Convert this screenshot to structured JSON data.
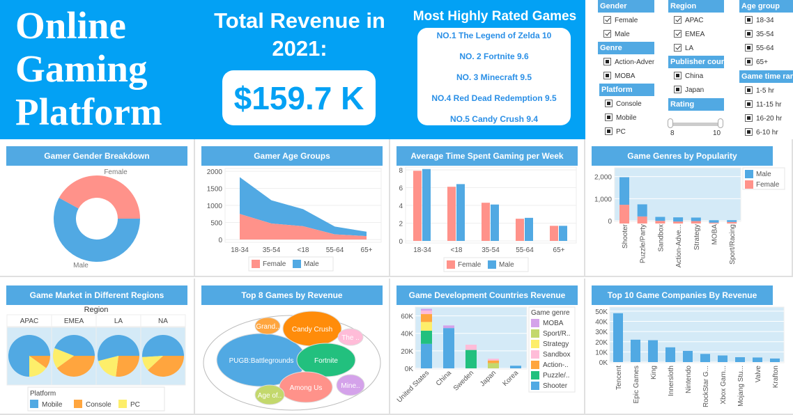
{
  "header": {
    "app_title": "Online Gaming Platform",
    "revenue_title": "Total Revenue in 2021:",
    "revenue_value": "$159.7 K",
    "rated_title": "Most Highly Rated Games",
    "rated_games": [
      "NO.1 The Legend of Zelda 10",
      "NO. 2 Fortnite  9.6",
      "NO. 3 Minecraft 9.5",
      "NO.4 Red Dead Redemption 9.5",
      "NO.5 Candy Crush  9.4"
    ]
  },
  "filters": {
    "gender": {
      "label": "Gender",
      "items": [
        {
          "label": "Female",
          "state": "checked"
        },
        {
          "label": "Male",
          "state": "checked"
        }
      ]
    },
    "genre": {
      "label": "Genre",
      "items": [
        {
          "label": "Action-Adventure",
          "state": "partial"
        },
        {
          "label": "MOBA",
          "state": "partial"
        }
      ]
    },
    "platform": {
      "label": "Platform",
      "items": [
        {
          "label": "Console",
          "state": "partial"
        },
        {
          "label": "Mobile",
          "state": "partial"
        },
        {
          "label": "PC",
          "state": "partial"
        }
      ]
    },
    "region": {
      "label": "Region",
      "items": [
        {
          "label": "APAC",
          "state": "checked"
        },
        {
          "label": "EMEA",
          "state": "checked"
        },
        {
          "label": "LA",
          "state": "checked"
        }
      ]
    },
    "publisher": {
      "label": "Publisher country",
      "items": [
        {
          "label": "China",
          "state": "partial"
        },
        {
          "label": "Japan",
          "state": "partial"
        }
      ]
    },
    "rating": {
      "label": "Rating",
      "min_label": "8",
      "max_label": "10",
      "range": [
        8,
        10
      ]
    },
    "age_group": {
      "label": "Age group",
      "items": [
        {
          "label": "18-34",
          "state": "partial"
        },
        {
          "label": "35-54",
          "state": "partial"
        },
        {
          "label": "55-64",
          "state": "partial"
        },
        {
          "label": "65+",
          "state": "partial"
        }
      ]
    },
    "game_time": {
      "label": "Game time range",
      "items": [
        {
          "label": "1-5 hr",
          "state": "partial"
        },
        {
          "label": "11-15 hr",
          "state": "partial"
        },
        {
          "label": "16-20 hr",
          "state": "partial"
        },
        {
          "label": "6-10 hr",
          "state": "partial"
        }
      ]
    }
  },
  "colors": {
    "banner": "#03a1f4",
    "panel_title": "#51a9e3",
    "male": "#51a9e3",
    "female": "#ff928a",
    "plot_bg": "#d4eaf7"
  },
  "chart_data": [
    {
      "id": "gender",
      "title": "Gamer Gender Breakdown",
      "type": "pie",
      "donut": true,
      "categories": [
        "Female",
        "Male"
      ],
      "values": [
        42,
        58
      ],
      "colors": [
        "#ff928a",
        "#51a9e3"
      ]
    },
    {
      "id": "age",
      "title": "Gamer Age Groups",
      "type": "area",
      "stacked": true,
      "categories": [
        "18-34",
        "35-54",
        "<18",
        "55-64",
        "65+"
      ],
      "series": [
        {
          "name": "Female",
          "values": [
            750,
            470,
            390,
            150,
            100
          ],
          "color": "#ff928a"
        },
        {
          "name": "Male",
          "values": [
            1080,
            680,
            500,
            230,
            130
          ],
          "color": "#51a9e3"
        }
      ],
      "yticks": [
        "0",
        "500",
        "1000",
        "1500",
        "2000"
      ],
      "ylim": [
        0,
        2000
      ],
      "legend": "bottom"
    },
    {
      "id": "time",
      "title": "Average Time Spent Gaming per Week",
      "type": "bar",
      "categories": [
        "18-34",
        "<18",
        "35-54",
        "55-64",
        "65+"
      ],
      "series": [
        {
          "name": "Female",
          "values": [
            7.9,
            6.1,
            4.3,
            2.5,
            1.7
          ],
          "color": "#ff928a"
        },
        {
          "name": "Male",
          "values": [
            8.1,
            6.4,
            4.1,
            2.6,
            1.7
          ],
          "color": "#51a9e3"
        }
      ],
      "yticks": [
        "0",
        "2",
        "4",
        "6",
        "8"
      ],
      "ylim": [
        0,
        8
      ],
      "legend": "bottom"
    },
    {
      "id": "genres",
      "title": "Game Genres by Popularity",
      "type": "bar",
      "stacked": true,
      "categories": [
        "Shooter",
        "Puzzle/Party",
        "Sandbox",
        "Action-Adve...",
        "Strategy",
        "MOBA",
        "Sport/Racing"
      ],
      "series": [
        {
          "name": "Female",
          "values": [
            850,
            320,
            120,
            90,
            110,
            40,
            70
          ],
          "color": "#ff928a"
        },
        {
          "name": "Male",
          "values": [
            1250,
            550,
            180,
            190,
            160,
            110,
            80
          ],
          "color": "#51a9e3"
        }
      ],
      "yticks": [
        "0",
        "1,000",
        "2,000"
      ],
      "ylim": [
        0,
        2400
      ],
      "legend": "right",
      "legend_order": [
        "Male",
        "Female"
      ]
    },
    {
      "id": "regions",
      "title": "Game Market in Different Regions",
      "type": "pie",
      "facet_label": "Region",
      "facets": [
        "APAC",
        "EMEA",
        "LA",
        "NA"
      ],
      "categories": [
        "Mobile",
        "Console",
        "PC"
      ],
      "series": [
        {
          "name": "APAC",
          "values": [
            75,
            10,
            15
          ]
        },
        {
          "name": "EMEA",
          "values": [
            44,
            40,
            16
          ]
        },
        {
          "name": "LA",
          "values": [
            54,
            27,
            19
          ]
        },
        {
          "name": "NA",
          "values": [
            51,
            38,
            11
          ]
        }
      ],
      "colors": [
        "#51a9e3",
        "#ffa53e",
        "#fdee6a"
      ],
      "legend_title": "Platform",
      "legend": "bottom"
    },
    {
      "id": "top8",
      "title": "Top 8 Games by Revenue",
      "type": "bubble",
      "labels": [
        "PUGB:Battlegrounds",
        "Candy Crush",
        "Fortnite",
        "Among Us",
        "Grand..",
        "The ..",
        "Mine..",
        "Age of.."
      ],
      "values": [
        100,
        38,
        37,
        30,
        11,
        8,
        14,
        13
      ],
      "colors": [
        "#51a9e3",
        "#ff8c0a",
        "#22c07e",
        "#ff928a",
        "#ffa53e",
        "#ffbcd8",
        "#d4a2ea",
        "#c3d86c"
      ]
    },
    {
      "id": "countries",
      "title": "Game Development Countries Revenue",
      "type": "bar",
      "stacked": true,
      "categories": [
        "United States",
        "China",
        "Sweden",
        "Japan",
        "Korea"
      ],
      "series": [
        {
          "name": "Shooter",
          "values": [
            28000,
            46000,
            0,
            0,
            3000
          ],
          "color": "#51a9e3"
        },
        {
          "name": "Puzzle/..",
          "values": [
            15000,
            0,
            21000,
            0,
            0
          ],
          "color": "#22c07e"
        },
        {
          "name": "Action-..",
          "values": [
            10000,
            0,
            0,
            3000,
            0
          ],
          "color": "#ffa53e"
        },
        {
          "name": "Sandbox",
          "values": [
            0,
            0,
            0,
            2000,
            0
          ],
          "color": "#ffbcd8"
        },
        {
          "name": "Strategy",
          "values": [
            0,
            0,
            0,
            0,
            0
          ],
          "color": "#fdee6a"
        },
        {
          "name": "Sport/R..",
          "values": [
            0,
            0,
            0,
            6000,
            0
          ],
          "color": "#c3d86c"
        },
        {
          "name": "MOBA",
          "values": [
            0,
            0,
            0,
            0,
            0
          ],
          "color": "#d4a2ea"
        }
      ],
      "stack_order_note": "US: Shooter 28K, Puzzle 15K, Strategy 10K, Action 9K, Sandbox 4K, MOBA 2K; China: Shooter 46K, MOBA 3K; Sweden: Puzzle 21K, Sandbox 6K; Japan: Sport 6K, Action 3K, Sandbox 2K; Korea: Shooter 3K",
      "stacks": [
        [
          [
            "Shooter",
            28000
          ],
          [
            "Puzzle/..",
            15000
          ],
          [
            "Strategy",
            10000
          ],
          [
            "Action-..",
            9000
          ],
          [
            "Sandbox",
            4000
          ],
          [
            "MOBA",
            2000
          ]
        ],
        [
          [
            "Shooter",
            46000
          ],
          [
            "MOBA",
            3000
          ]
        ],
        [
          [
            "Puzzle/..",
            21000
          ],
          [
            "Sandbox",
            6000
          ]
        ],
        [
          [
            "Sport/R..",
            6000
          ],
          [
            "Action-..",
            3000
          ],
          [
            "Sandbox",
            2000
          ]
        ],
        [
          [
            "Shooter",
            3000
          ]
        ]
      ],
      "yticks": [
        "0K",
        "20K",
        "40K",
        "60K"
      ],
      "ylim": [
        0,
        70000
      ],
      "legend_title": "Game genre",
      "legend_items": [
        {
          "name": "MOBA",
          "color": "#d4a2ea"
        },
        {
          "name": "Sport/R..",
          "color": "#c3d86c"
        },
        {
          "name": "Strategy",
          "color": "#fdee6a"
        },
        {
          "name": "Sandbox",
          "color": "#ffbcd8"
        },
        {
          "name": "Action-..",
          "color": "#ffa53e"
        },
        {
          "name": "Puzzle/..",
          "color": "#22c07e"
        },
        {
          "name": "Shooter",
          "color": "#51a9e3"
        }
      ],
      "legend": "right"
    },
    {
      "id": "companies",
      "title": "Top 10 Game Companies By Revenue",
      "type": "bar",
      "categories": [
        "Tencent",
        "Epic Games",
        "King",
        "Innersloth",
        "Nintendo",
        "RockStar G...",
        "Xbox Gam...",
        "Mojang Stu...",
        "Valve",
        "Krafton"
      ],
      "values": [
        48000,
        22000,
        21500,
        14500,
        11000,
        8000,
        6500,
        4800,
        4500,
        3500
      ],
      "yticks": [
        "0K",
        "10K",
        "20K",
        "30K",
        "40K",
        "50K"
      ],
      "ylim": [
        0,
        52000
      ],
      "color": "#51a9e3"
    }
  ]
}
